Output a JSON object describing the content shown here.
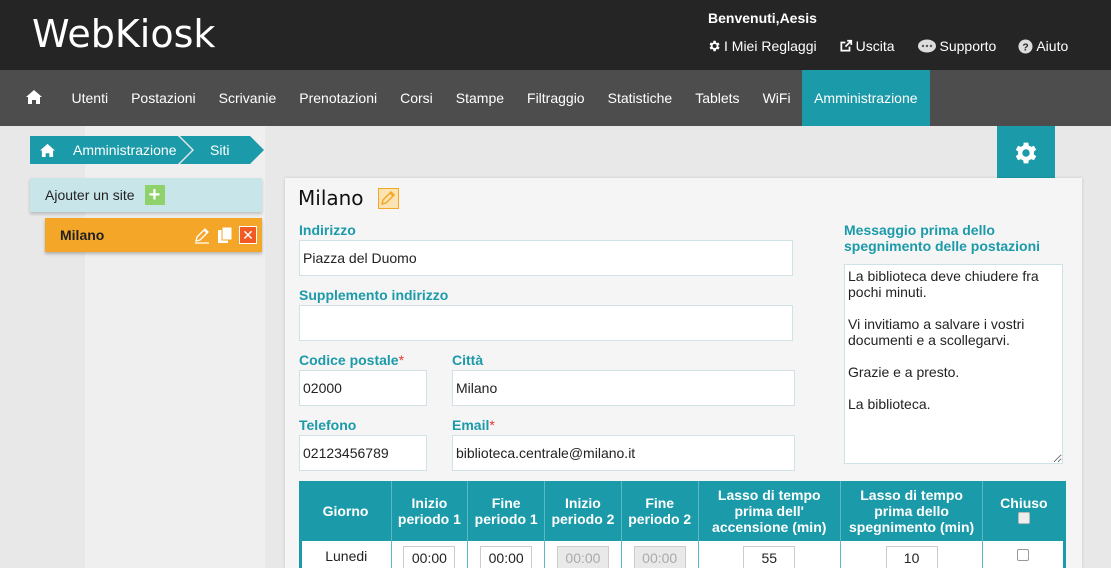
{
  "app": {
    "logo": "WebKiosk"
  },
  "header": {
    "welcome": "Benvenuti,Aesis",
    "links": [
      {
        "label": "I Miei Reglaggi",
        "icon": "gear-icon"
      },
      {
        "label": "Uscita",
        "icon": "exit-icon"
      },
      {
        "label": "Supporto",
        "icon": "chat-icon"
      },
      {
        "label": "Aiuto",
        "icon": "help-icon"
      }
    ]
  },
  "nav": {
    "items": [
      "Utenti",
      "Postazioni",
      "Scrivanie",
      "Prenotazioni",
      "Corsi",
      "Stampe",
      "Filtraggio",
      "Statistiche",
      "Tablets",
      "WiFi",
      "Amministrazione"
    ],
    "active": "Amministrazione"
  },
  "breadcrumb": [
    "Amministrazione",
    "Siti"
  ],
  "sidebar": {
    "add_label": "Ajouter un site",
    "sites": [
      {
        "name": "Milano",
        "selected": true
      }
    ]
  },
  "form": {
    "site_name": "Milano",
    "indirizzo": {
      "label": "Indirizzo",
      "value": "Piazza del Duomo"
    },
    "supplemento": {
      "label": "Supplemento indirizzo",
      "value": ""
    },
    "codice_postale": {
      "label": "Codice postale",
      "value": "02000",
      "required": true
    },
    "citta": {
      "label": "Città",
      "value": "Milano"
    },
    "telefono": {
      "label": "Telefono",
      "value": "02123456789"
    },
    "email": {
      "label": "Email",
      "value": "biblioteca.centrale@milano.it",
      "required": true
    },
    "messaggio": {
      "label_line1": "Messaggio prima dello",
      "label_line2": "spegnimento delle postazioni",
      "value": "La biblioteca deve chiudere fra pochi minuti.\n\nVi invitiamo a salvare i vostri documenti e a scollegarvi.\n\nGrazie e a presto.\n\nLa biblioteca."
    }
  },
  "schedule": {
    "headers": {
      "giorno": "Giorno",
      "inizio1_a": "Inizio",
      "inizio1_b": "periodo 1",
      "fine1_a": "Fine",
      "fine1_b": "periodo 1",
      "inizio2_a": "Inizio",
      "inizio2_b": "periodo 2",
      "fine2_a": "Fine",
      "fine2_b": "periodo 2",
      "lasso_acc_a": "Lasso di tempo",
      "lasso_acc_b": "prima dell'",
      "lasso_acc_c": "accensione (min)",
      "lasso_sp_a": "Lasso di tempo",
      "lasso_sp_b": "prima dello",
      "lasso_sp_c": "spegnimento (min)",
      "chiuso": "Chiuso"
    },
    "rows": [
      {
        "giorno": "Lunedi",
        "inizio1": "00:00",
        "fine1": "00:00",
        "inizio2": "00:00",
        "fine2": "00:00",
        "lasso_acc": "55",
        "lasso_sp": "10",
        "chiuso": false
      }
    ]
  },
  "colors": {
    "accent": "#1b9aaa",
    "orange": "#f4a629",
    "dark": "#252525",
    "nav": "#4d4d4d"
  }
}
